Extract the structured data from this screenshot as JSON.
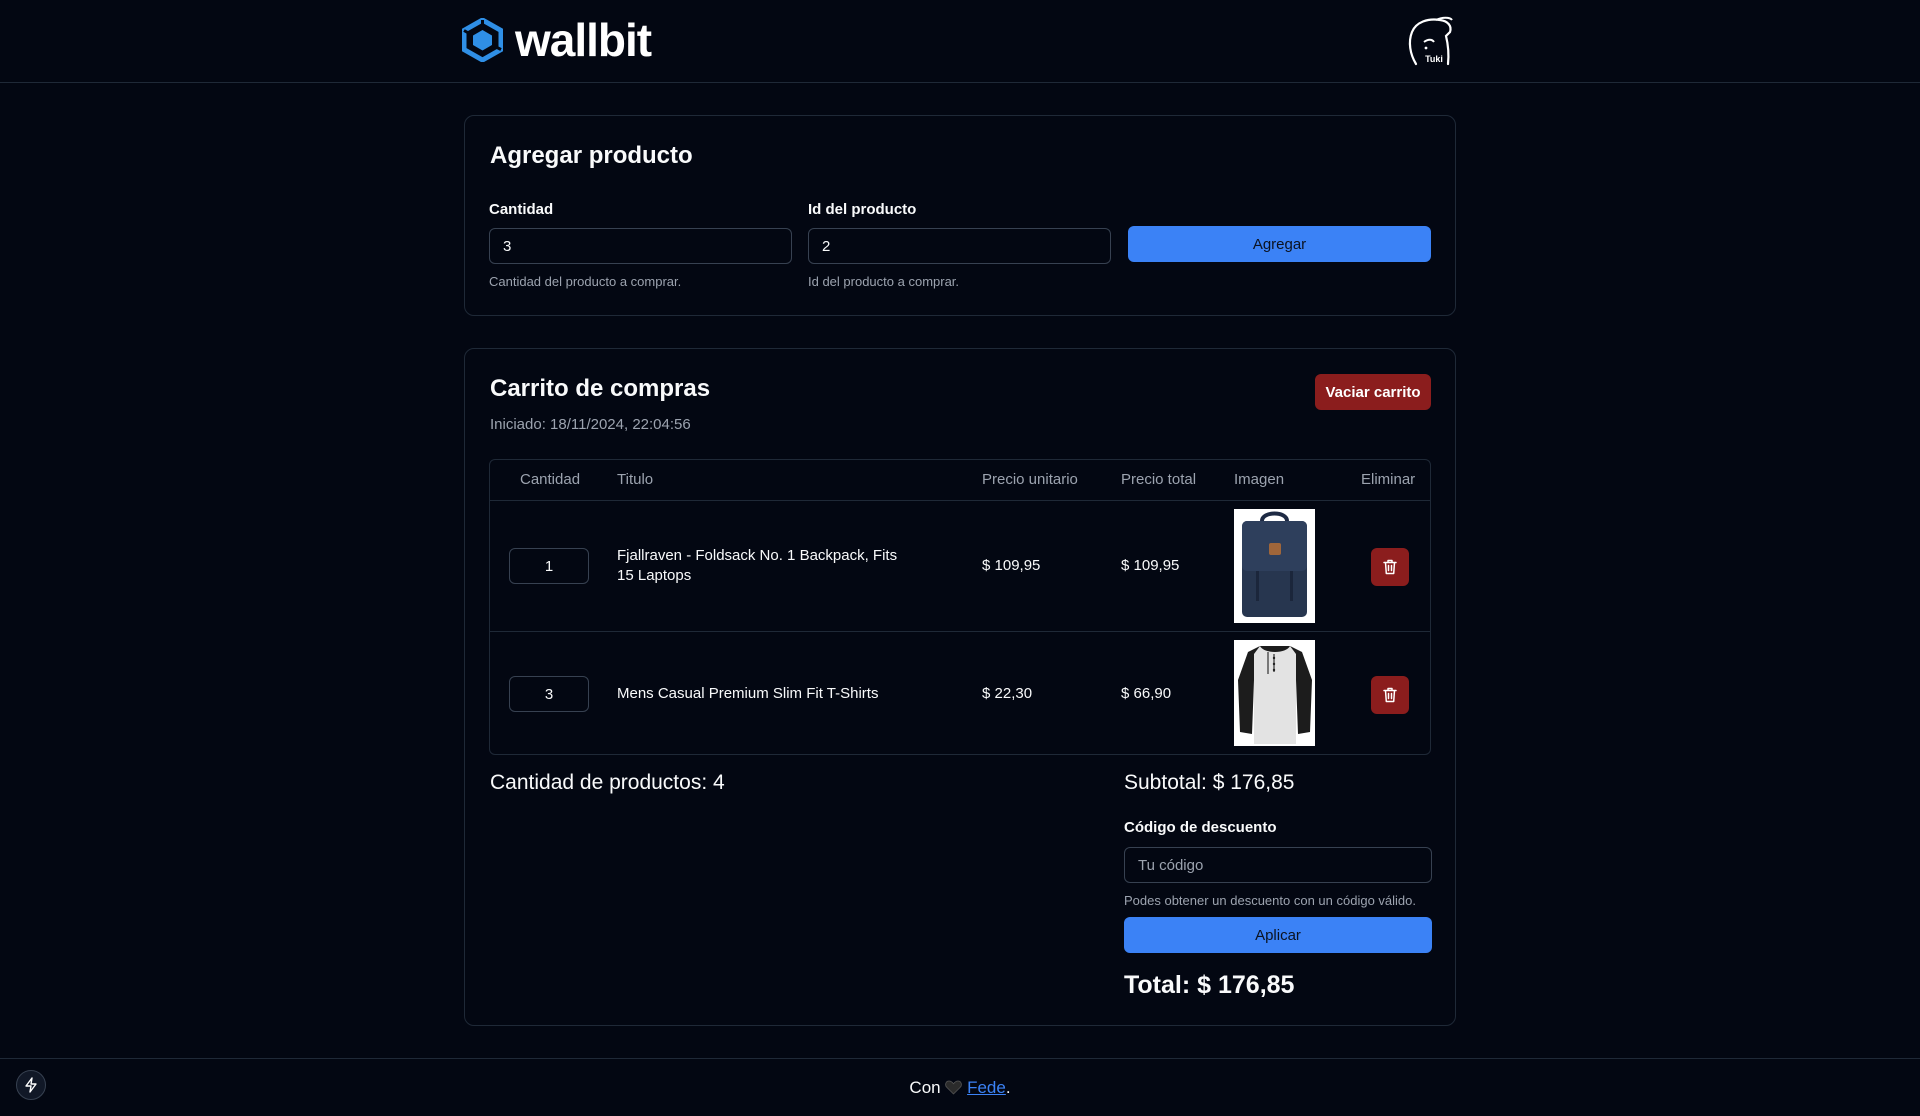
{
  "brand": {
    "name": "wallbit",
    "accent": "#3b82f6"
  },
  "avatar": {
    "caption": "Tuki"
  },
  "add_product": {
    "title": "Agregar producto",
    "quantity_label": "Cantidad",
    "quantity_value": "3",
    "quantity_hint": "Cantidad del producto a comprar.",
    "product_id_label": "Id del producto",
    "product_id_value": "2",
    "product_id_hint": "Id del producto a comprar.",
    "submit_label": "Agregar"
  },
  "cart": {
    "title": "Carrito de compras",
    "started": "Iniciado: 18/11/2024, 22:04:56",
    "clear_label": "Vaciar carrito",
    "columns": {
      "quantity": "Cantidad",
      "title": "Titulo",
      "unit_price": "Precio unitario",
      "total_price": "Precio total",
      "image": "Imagen",
      "remove": "Eliminar"
    },
    "rows": [
      {
        "quantity": "1",
        "title": "Fjallraven - Foldsack No. 1 Backpack, Fits 15 Laptops",
        "unit_price": "$ 109,95",
        "total_price": "$ 109,95",
        "image_icon": "backpack-image"
      },
      {
        "quantity": "3",
        "title": "Mens Casual Premium Slim Fit T-Shirts",
        "unit_price": "$ 22,30",
        "total_price": "$ 66,90",
        "image_icon": "tshirt-image"
      }
    ],
    "product_count": "Cantidad de productos: 4",
    "subtotal": "Subtotal: $ 176,85",
    "discount_label": "Código de descuento",
    "discount_placeholder": "Tu código",
    "discount_hint": "Podes obtener un descuento con un código válido.",
    "apply_label": "Aplicar",
    "total": "Total: $ 176,85"
  },
  "footer": {
    "prefix": "Con",
    "heart_icon": "black-heart-icon",
    "author": "Fede",
    "suffix": "."
  },
  "colors": {
    "background": "#030712",
    "border": "#1f2937",
    "danger": "#8b1d1d",
    "primary": "#3b82f6"
  }
}
